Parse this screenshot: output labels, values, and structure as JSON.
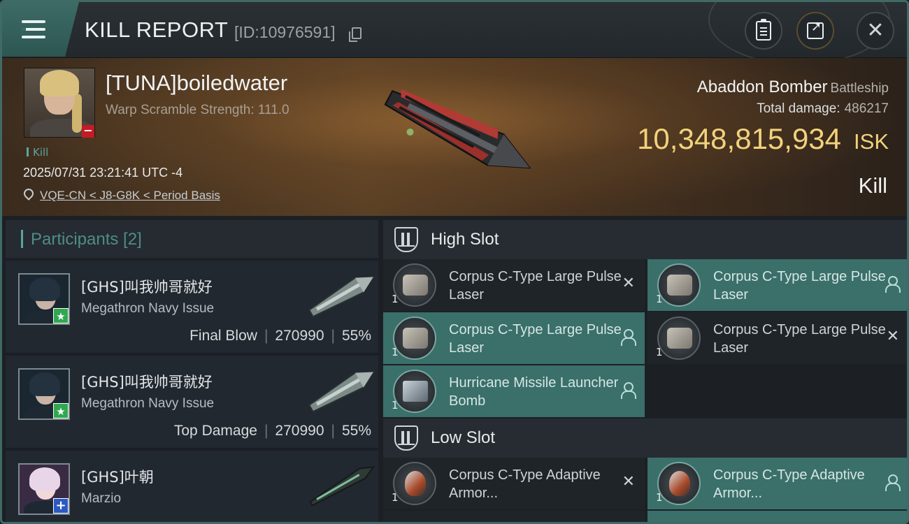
{
  "header": {
    "title": "KILL REPORT",
    "report_id": "[ID:10976591]"
  },
  "victim": {
    "name": "[TUNA]boiledwater",
    "warp_scramble": "Warp Scramble Strength: 111.0",
    "kill_tag": "Kill",
    "timestamp": "2025/07/31 23:21:41 UTC -4",
    "location": "VQE-CN < J8-G8K < Period Basis",
    "ship_name": "Abaddon Bomber",
    "ship_class": "Battleship",
    "total_damage_label": "Total damage:",
    "total_damage": "486217",
    "isk_value": "10,348,815,934",
    "isk_unit": "ISK",
    "result": "Kill"
  },
  "participants": {
    "header": "Participants [2]",
    "list": [
      {
        "name": "[GHS]叫我帅哥就好",
        "ship": "Megathron Navy Issue",
        "role": "Final Blow",
        "damage": "270990",
        "percent": "55%"
      },
      {
        "name": "[GHS]叫我帅哥就好",
        "ship": "Megathron Navy Issue",
        "role": "Top Damage",
        "damage": "270990",
        "percent": "55%"
      },
      {
        "name": "[GHS]叶朝",
        "ship": "Marzio"
      }
    ]
  },
  "slots": {
    "high": {
      "label": "High Slot",
      "modules": [
        {
          "name": "Corpus C-Type Large Pulse Laser",
          "qty": "1",
          "status": "destroyed"
        },
        {
          "name": "Corpus C-Type Large Pulse Laser",
          "qty": "1",
          "status": "dropped"
        },
        {
          "name": "Corpus C-Type Large Pulse Laser",
          "qty": "1",
          "status": "dropped"
        },
        {
          "name": "Corpus C-Type Large Pulse Laser",
          "qty": "1",
          "status": "destroyed"
        },
        {
          "name": "Hurricane Missile Launcher Bomb",
          "qty": "1",
          "status": "dropped"
        }
      ]
    },
    "low": {
      "label": "Low Slot",
      "modules": [
        {
          "name": "Corpus C-Type Adaptive Armor...",
          "qty": "1",
          "status": "destroyed"
        },
        {
          "name": "Corpus C-Type Adaptive Armor...",
          "qty": "1",
          "status": "dropped"
        }
      ]
    }
  },
  "colors": {
    "accent_teal": "#3a6f6a",
    "isk_gold": "#f2d27c",
    "lossmark_red": "#c21d24"
  }
}
